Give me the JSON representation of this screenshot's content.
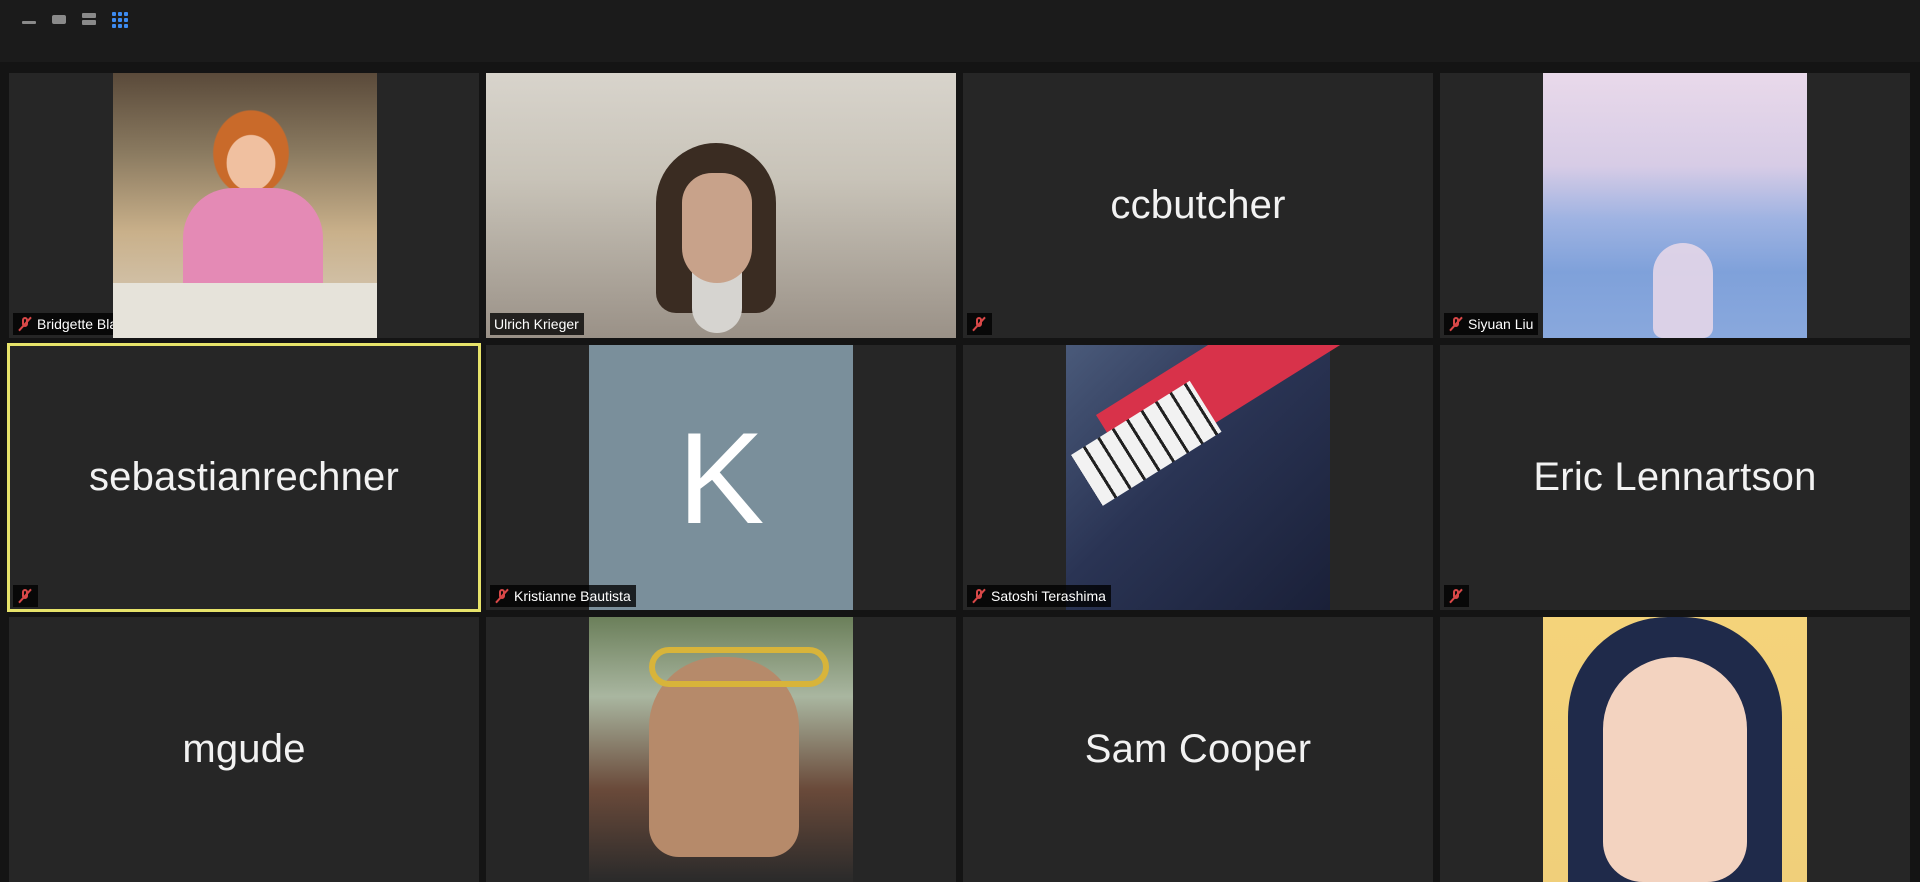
{
  "toolbar": {
    "view_icons": [
      "minimize-icon",
      "speaker-view-icon",
      "strip-view-icon",
      "gallery-view-icon"
    ],
    "active_view": "gallery-view-icon",
    "accent": "#3d8bf0"
  },
  "participants": [
    {
      "name": "Bridgette Blankenhorn",
      "display": "",
      "muted": true,
      "video": "photo"
    },
    {
      "name": "Ulrich Krieger",
      "display": "",
      "muted": false,
      "video": "photo"
    },
    {
      "name": "",
      "display": "ccbutcher",
      "muted": true,
      "video": "off"
    },
    {
      "name": "Siyuan Liu",
      "display": "",
      "muted": true,
      "video": "photo"
    },
    {
      "name": "",
      "display": "sebastianrechner",
      "muted": true,
      "video": "off",
      "active_speaker": true
    },
    {
      "name": "Kristianne Bautista",
      "display": "",
      "muted": true,
      "video": "avatar",
      "avatar_letter": "K"
    },
    {
      "name": "Satoshi Terashima",
      "display": "",
      "muted": true,
      "video": "photo"
    },
    {
      "name": "",
      "display": "Eric Lennartson",
      "muted": true,
      "video": "off"
    },
    {
      "name": "",
      "display": "mgude",
      "muted": false,
      "video": "off"
    },
    {
      "name": "",
      "display": "",
      "muted": false,
      "video": "photo"
    },
    {
      "name": "",
      "display": "Sam Cooper",
      "muted": false,
      "video": "off"
    },
    {
      "name": "",
      "display": "",
      "muted": false,
      "video": "photo"
    }
  ],
  "colors": {
    "background": "#141414",
    "tile": "#262626",
    "active_speaker_border": "#e7e36a",
    "muted_icon": "#d94848"
  }
}
